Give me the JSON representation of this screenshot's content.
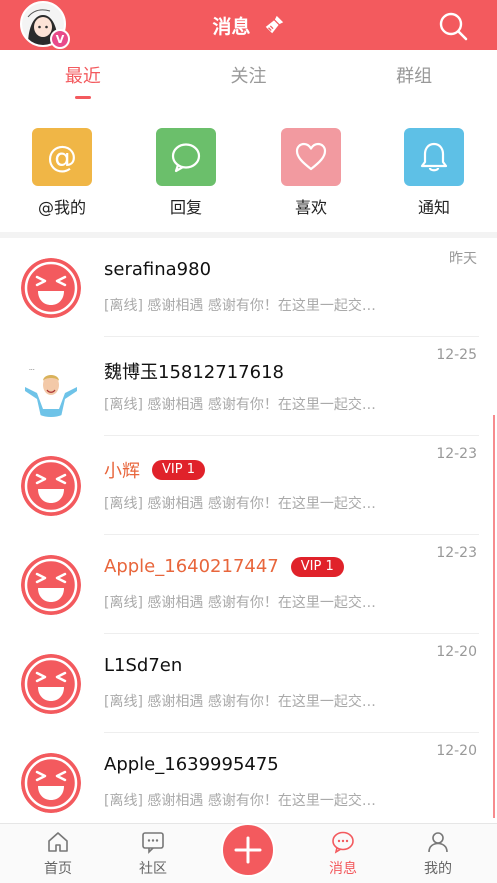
{
  "header": {
    "title": "消息",
    "bg_color": "#f35a5e",
    "avatar_badge": "V"
  },
  "tabs": [
    {
      "label": "最近",
      "active": true
    },
    {
      "label": "关注",
      "active": false
    },
    {
      "label": "群组",
      "active": false
    }
  ],
  "quick_actions": [
    {
      "label": "@我的",
      "icon": "at-icon",
      "color": "#f0b646",
      "glyph": "@"
    },
    {
      "label": "回复",
      "icon": "chat-bubble-icon",
      "color": "#6bbf6b"
    },
    {
      "label": "喜欢",
      "icon": "heart-icon",
      "color": "#f29aa0"
    },
    {
      "label": "通知",
      "icon": "bell-icon",
      "color": "#5ec0e6"
    }
  ],
  "messages": [
    {
      "name": "serafina980",
      "time": "昨天",
      "preview": "[离线] 感谢相遇 感谢有你！在这里一起交…",
      "vip": false,
      "avatar": "laughing-face"
    },
    {
      "name": "魏博玉15812717618",
      "time": "12-25",
      "preview": "[离线] 感谢相遇 感谢有你！在这里一起交…",
      "vip": false,
      "avatar": "photo"
    },
    {
      "name": "小辉",
      "time": "12-23",
      "preview": "[离线] 感谢相遇 感谢有你！在这里一起交…",
      "vip": true,
      "vip_label": "VIP 1",
      "avatar": "laughing-face"
    },
    {
      "name": "Apple_1640217447",
      "time": "12-23",
      "preview": "[离线] 感谢相遇 感谢有你！在这里一起交…",
      "vip": true,
      "vip_label": "VIP 1",
      "avatar": "laughing-face"
    },
    {
      "name": "L1Sd7en",
      "time": "12-20",
      "preview": "[离线] 感谢相遇 感谢有你！在这里一起交…",
      "vip": false,
      "avatar": "laughing-face"
    },
    {
      "name": "Apple_1639995475",
      "time": "12-20",
      "preview": "[离线] 感谢相遇 感谢有你！在这里一起交…",
      "vip": false,
      "avatar": "laughing-face"
    }
  ],
  "bottom_nav": [
    {
      "label": "首页",
      "icon": "home-icon",
      "active": false
    },
    {
      "label": "社区",
      "icon": "community-icon",
      "active": false
    },
    {
      "label": "消息",
      "icon": "message-icon",
      "active": true
    },
    {
      "label": "我的",
      "icon": "profile-icon",
      "active": false
    }
  ]
}
